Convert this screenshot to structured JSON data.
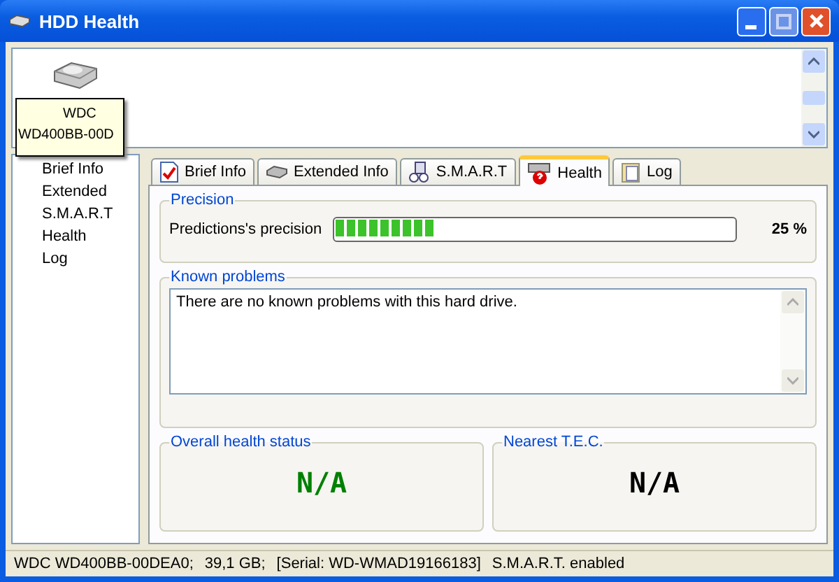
{
  "window": {
    "title": "HDD Health"
  },
  "drives": [
    {
      "tooltip": [
        "WDC",
        "WD400BB-00D"
      ]
    }
  ],
  "sidebar": {
    "items": [
      {
        "label": "Brief Info",
        "selected": false
      },
      {
        "label": "Extended",
        "selected": false
      },
      {
        "label": "S.M.A.R.T",
        "selected": false
      },
      {
        "label": "Health",
        "selected": false
      },
      {
        "label": "Log",
        "selected": false
      }
    ]
  },
  "tabs": [
    {
      "label": "Brief Info",
      "kind": "doc",
      "selected": false
    },
    {
      "label": "Extended Info",
      "kind": "drive",
      "selected": false
    },
    {
      "label": "S.M.A.R.T",
      "kind": "smart",
      "selected": false
    },
    {
      "label": "Health",
      "kind": "health",
      "selected": true
    },
    {
      "label": "Log",
      "kind": "log",
      "selected": false
    }
  ],
  "precision": {
    "title": "Precision",
    "label": "Predictions's precision",
    "level": 0.25,
    "reading": "25 %"
  },
  "known_problems": {
    "title": "Known problems",
    "text": "There are no known problems with this hard drive."
  },
  "overall_health": {
    "title": "Overall health status",
    "value": "N/A",
    "color": "#008000"
  },
  "nearest_tec": {
    "title": "Nearest T.E.C.",
    "value": "N/A",
    "color": "#000000"
  },
  "status_bar": [
    "WDC WD400BB-00DEA0;",
    "39,1 GB;",
    "[Serial: WD-WMAD19166183]",
    "S.M.A.R.T. enabled"
  ]
}
